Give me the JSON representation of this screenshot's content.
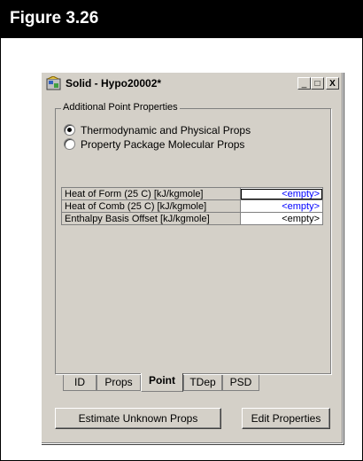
{
  "figure": {
    "title": "Figure 3.26"
  },
  "window": {
    "title": "Solid - Hypo20002*",
    "controls": {
      "minimize": "_",
      "maximize": "□",
      "close": "X"
    }
  },
  "group": {
    "label": "Additional Point Properties",
    "options": [
      {
        "label": "Thermodynamic and Physical Props",
        "selected": true
      },
      {
        "label": "Property Package Molecular Props",
        "selected": false
      }
    ]
  },
  "table": {
    "rows": [
      {
        "label": "Heat of Form (25 C) [kJ/kgmole]",
        "value": "<empty>"
      },
      {
        "label": "Heat of Comb (25 C) [kJ/kgmole]",
        "value": "<empty>"
      },
      {
        "label": "Enthalpy Basis Offset [kJ/kgmole]",
        "value": "<empty>"
      }
    ]
  },
  "tabs": [
    {
      "label": "ID"
    },
    {
      "label": "Props"
    },
    {
      "label": "Point",
      "active": true
    },
    {
      "label": "TDep"
    },
    {
      "label": "PSD"
    }
  ],
  "buttons": {
    "estimate": "Estimate Unknown Props",
    "edit": "Edit Properties"
  },
  "colors": {
    "empty_link": "#0000ff",
    "face": "#d4d0c8"
  }
}
